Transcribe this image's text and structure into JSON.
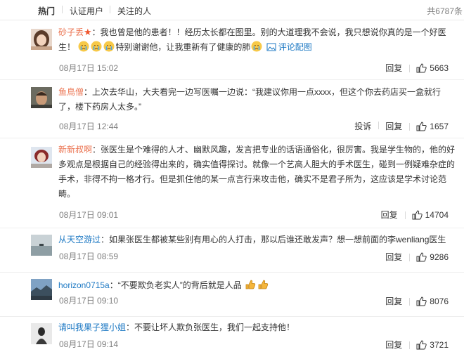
{
  "tabs": [
    {
      "label": "热门",
      "active": true
    },
    {
      "label": "认证用户",
      "active": false
    },
    {
      "label": "关注的人",
      "active": false
    }
  ],
  "total": "共6787条",
  "comments": [
    {
      "user": "砂子丢",
      "text_a": "：我也曾是他的患者！！经历太长都在图里。别的大道理我不会说，我只想说你真的是一个好医生！",
      "text_b": "特别谢谢他，让我重新有了健康的肺",
      "pic_link": "评论配图",
      "time": "08月17日 15:02",
      "reply": "回复",
      "likes": "5663"
    },
    {
      "user": "鱼鳥僧",
      "text": "：上次去华山，大夫看完一边写医嘱一边说：“我建议你用一点xxxx，但这个你去药店买一盒就行了，楼下药房人太多。”",
      "time": "08月17日 12:44",
      "report": "投诉",
      "reply": "回复",
      "likes": "1657"
    },
    {
      "user": "新新叔啊",
      "text": "：张医生是个难得的人才、幽默风趣，发言把专业的话语通俗化，很厉害。我是学生物的，他的好多观点是根据自己的经验得出来的，确实值得探讨。就像一个艺高人胆大的手术医生，碰到一例疑难杂症的手术，非得不拘一格才行。但是抓住他的某一点言行来攻击他，确实不是君子所为，这应该是学术讨论范畴。",
      "time": "08月17日 09:01",
      "reply": "回复",
      "likes": "14704"
    },
    {
      "user": "从天空游过",
      "text": "：如果张医生都被某些别有用心的人打击，那以后谁还敢发声？想一想前面的李wenliang医生",
      "time": "08月17日 08:59",
      "reply": "回复",
      "likes": "9286"
    },
    {
      "user": "horizon0715a",
      "text": "：“不要欺负老实人”的背后就是人品",
      "time": "08月17日 09:10",
      "reply": "回复",
      "likes": "8076"
    },
    {
      "user": "请叫我果子狸小姐",
      "text": "：不要让坏人欺负张医生，我们一起支持他！",
      "time": "08月17日 09:14",
      "reply": "回复",
      "likes": "3721"
    }
  ],
  "colors": {
    "username": "#eb7350",
    "link": "#1f7ac4",
    "meta": "#808080"
  }
}
